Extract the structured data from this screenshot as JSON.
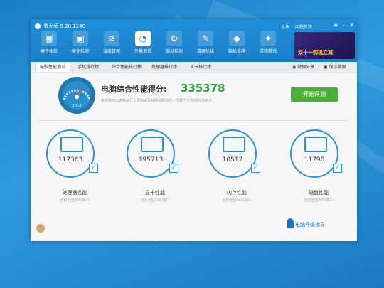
{
  "app": {
    "title": "鲁大师 5.20.1240"
  },
  "toolbar": {
    "items": [
      {
        "label": "硬件体检",
        "icon": "hardware-check-icon"
      },
      {
        "label": "硬件检测",
        "icon": "hardware-detect-icon"
      },
      {
        "label": "温度管理",
        "icon": "temperature-icon"
      },
      {
        "label": "性能测试",
        "icon": "performance-icon"
      },
      {
        "label": "驱动检测",
        "icon": "driver-icon"
      },
      {
        "label": "清理优化",
        "icon": "cleanup-icon"
      },
      {
        "label": "装机推荐",
        "icon": "recommend-icon"
      },
      {
        "label": "游戏精选",
        "icon": "game-icon"
      }
    ],
    "links": {
      "forum": "论坛",
      "feedback": "问题反馈"
    },
    "promo": "双十一购机立减"
  },
  "tabs": [
    {
      "label": "电脑性能测试"
    },
    {
      "label": "手机排行榜"
    },
    {
      "label": "综合性能排行榜"
    },
    {
      "label": "处理器排行榜"
    },
    {
      "label": "显卡排行榜"
    }
  ],
  "share": {
    "weibo": "微博分享",
    "save": "保存截屏"
  },
  "score": {
    "label": "电脑综合性能得分:",
    "value": "335378",
    "gauge_value": "2014",
    "description": "本电脑可以流畅运行大型游戏及各种视频软件，击败了全国84%的用户",
    "start_button": "开始评测"
  },
  "cards": [
    {
      "value": "117363",
      "name": "处理器性能",
      "beat": "击败全国89%用户",
      "icon": "monitor-icon"
    },
    {
      "value": "195713",
      "name": "显卡性能",
      "beat": "击败全国91%用户",
      "icon": "gpu-icon"
    },
    {
      "value": "10512",
      "name": "内存性能",
      "beat": "击败全国54%用户",
      "icon": "memory-icon"
    },
    {
      "value": "11790",
      "name": "磁盘性能",
      "beat": "击败全国68%用户",
      "icon": "disk-icon"
    }
  ],
  "footer": {
    "upgrade": "电脑升级指导"
  },
  "colors": {
    "accent": "#1c80c9",
    "score_green": "#2e9a3c",
    "button_green": "#4caf3a"
  }
}
